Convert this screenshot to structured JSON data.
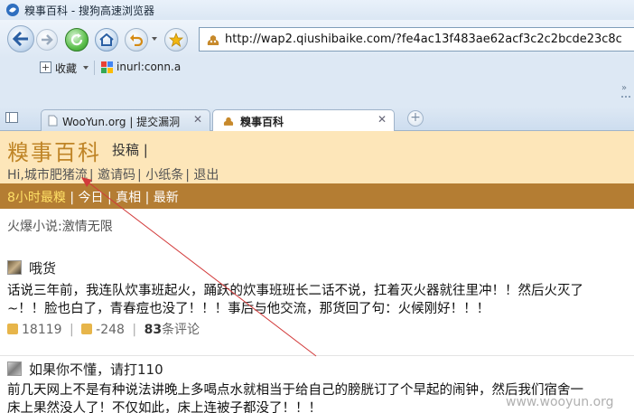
{
  "window": {
    "title": "糗事百科 - 搜狗高速浏览器"
  },
  "address_bar": {
    "url": "http://wap2.qiushibaike.com/?fe4ac13f483ae62acf3c2c2bcde23c8c"
  },
  "bookmarks": {
    "favorites_label": "收藏",
    "link_label": "inurl:conn.a"
  },
  "tabs": [
    {
      "label": "WooYun.org | 提交漏洞",
      "active": false
    },
    {
      "label": "糗事百科",
      "active": true
    }
  ],
  "site": {
    "logo": "糗事百科",
    "post_link": "投稿 |",
    "user_links": [
      "Hi,城市肥猪流",
      "邀请码",
      "小纸条",
      "退出"
    ],
    "nav": [
      "8小时最糗",
      "今日",
      "真相",
      "最新"
    ],
    "promo": "火爆小说:激情无限"
  },
  "posts": [
    {
      "author": "哦货",
      "lines": [
        "话说三年前，我连队炊事班起火，踊跃的炊事班班长二话不说，扛着灭火器就往里冲！！然后火灭了",
        "~！！脸也白了，青春痘也没了！！！事后与他交流，那货回了句：火候刚好！！！"
      ],
      "up": "18119",
      "down": "-248",
      "comments": "83",
      "comments_suffix": "条评论"
    },
    {
      "author": "如果你不懂，请打110",
      "lines": [
        "前几天网上不是有种说法讲晚上多喝点水就相当于给自己的膀胱订了个早起的闹钟，然后我们宿舍一",
        "床上果然没人了！不仅如此，床上连被子都没了！！！"
      ]
    }
  ],
  "watermark": "www.wooyun.org",
  "colors": {
    "header_bg": "#fde6b9",
    "nav_bg": "#b47d33",
    "logo": "#bf8426",
    "nav_active": "#ffe066",
    "annotation_arrow": "#d23a3a"
  }
}
